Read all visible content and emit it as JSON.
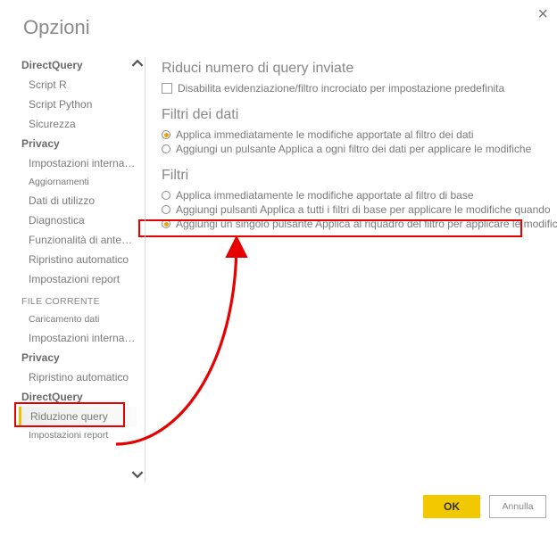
{
  "window": {
    "title": "Opzioni"
  },
  "sidebar": {
    "group1": {
      "heading": "DirectQuery",
      "items": [
        "Script R",
        "Script Python",
        "Sicurezza"
      ]
    },
    "group2": {
      "heading": "Privacy",
      "items": [
        "Impostazioni internazionali",
        "Aggiornamenti",
        "Dati di utilizzo",
        "Diagnostica",
        "Funzionalità di anteprima",
        "Ripristino automatico",
        "Impostazioni report"
      ]
    },
    "file_section_label": "FILE CORRENTE",
    "group3": {
      "items": [
        "Caricamento dati",
        "Impostazioni internazionali"
      ]
    },
    "group4": {
      "heading": "Privacy",
      "items": [
        "Ripristino automatico"
      ]
    },
    "group5": {
      "heading": "DirectQuery",
      "selected": "Riduzione query",
      "after": "Impostazioni report"
    }
  },
  "main": {
    "h_reduce": "Riduci numero di query inviate",
    "cb_disable": "Disabilita evidenziazione/filtro incrociato per impostazione predefinita",
    "h_datafilters": "Filtri dei dati",
    "r_data_1": "Applica immediatamente le modifiche apportate al filtro dei dati",
    "r_data_2": "Aggiungi un pulsante Applica a ogni filtro dei dati per applicare le modifiche",
    "h_filters": "Filtri",
    "r_f_1": "Applica immediatamente le modifiche apportate al filtro di base",
    "r_f_2": "Aggiungi pulsanti Applica a tutti i filtri di base per applicare le modifiche quando",
    "r_f_3": "Aggiungi un singolo pulsante Applica al riquadro del filtro per applicare le modifiche"
  },
  "buttons": {
    "ok": "OK",
    "cancel": "Annulla"
  },
  "colors": {
    "accent": "#f2c800",
    "annotation": "#e60000"
  }
}
